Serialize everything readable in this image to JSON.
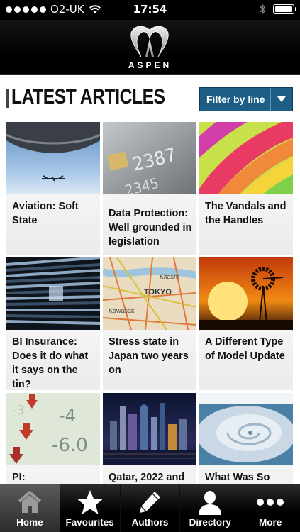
{
  "status_bar": {
    "carrier": "O2-UK",
    "time": "17:54"
  },
  "header": {
    "logo_text": "ASPEN"
  },
  "page": {
    "title": "LATEST ARTICLES",
    "filter_label": "Filter by line"
  },
  "articles": [
    {
      "title": "Aviation: Soft State",
      "image": "airplane-photo"
    },
    {
      "title": "Data Protection: Well grounded in legislation",
      "image": "credit-card-photo"
    },
    {
      "title": "The Vandals and the Handles",
      "image": "colorful-spiral-photo"
    },
    {
      "title": "BI Insurance: Does it do what it says on the tin?",
      "image": "server-rack-photo"
    },
    {
      "title": "Stress state in Japan two years on",
      "image": "japan-map-photo"
    },
    {
      "title": "A Different Type of Model Update",
      "image": "windmill-sunset-photo"
    },
    {
      "title": "PI:",
      "image": "stock-numbers-photo"
    },
    {
      "title": "Qatar, 2022 and",
      "image": "city-skyline-photo"
    },
    {
      "title": "What Was So",
      "image": "hurricane-satellite-photo"
    }
  ],
  "tabs": [
    {
      "label": "Home",
      "icon": "home-icon",
      "active": true
    },
    {
      "label": "Favourites",
      "icon": "star-icon",
      "active": false
    },
    {
      "label": "Authors",
      "icon": "pencil-icon",
      "active": false
    },
    {
      "label": "Directory",
      "icon": "person-icon",
      "active": false
    },
    {
      "label": "More",
      "icon": "more-dots-icon",
      "active": false
    }
  ]
}
